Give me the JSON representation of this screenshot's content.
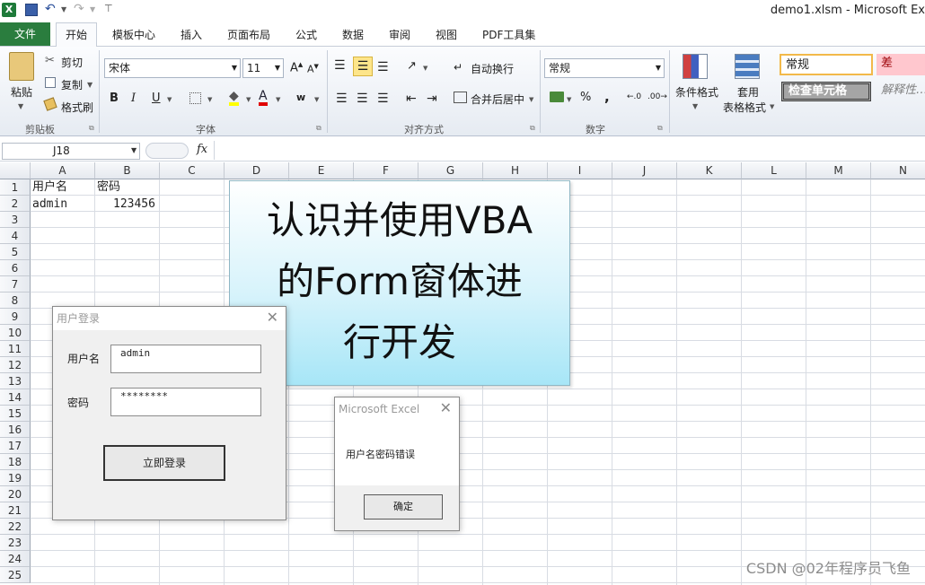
{
  "window": {
    "title": "demo1.xlsm - Microsoft Ex"
  },
  "tabs": [
    "文件",
    "开始",
    "模板中心",
    "插入",
    "页面布局",
    "公式",
    "数据",
    "审阅",
    "视图",
    "PDF工具集"
  ],
  "ribbon": {
    "clipboard": {
      "paste": "粘贴",
      "cut": "剪切",
      "copy": "复制",
      "format_painter": "格式刷",
      "label": "剪贴板"
    },
    "font": {
      "name": "宋体",
      "size": "11",
      "label": "字体"
    },
    "alignment": {
      "wrap": "自动换行",
      "merge": "合并后居中",
      "label": "对齐方式"
    },
    "number": {
      "format": "常规",
      "label": "数字"
    },
    "styles": {
      "conditional": "条件格式",
      "table_line1": "套用",
      "table_line2": "表格格式",
      "normal": "常规",
      "bad": "差",
      "check_cell": "检查单元格",
      "explanatory": "解释性…"
    }
  },
  "formula_bar": {
    "cell_ref": "J18",
    "fx": "fx",
    "value": ""
  },
  "columns": [
    "A",
    "B",
    "C",
    "D",
    "E",
    "F",
    "G",
    "H",
    "I",
    "J",
    "K",
    "L",
    "M",
    "N"
  ],
  "rows": [
    "1",
    "2",
    "3",
    "4",
    "5",
    "6",
    "7",
    "8",
    "9",
    "10",
    "11",
    "12",
    "13",
    "14",
    "15",
    "16",
    "17",
    "18",
    "19",
    "20",
    "21",
    "22",
    "23",
    "24",
    "25"
  ],
  "cells": {
    "A1": "用户名",
    "B1": "密码",
    "A2": "admin",
    "B2": "123456"
  },
  "shape_text": {
    "line1": "认识并使用VBA",
    "line2": "的Form窗体进",
    "line3": "行开发"
  },
  "login_dialog": {
    "title": "用户登录",
    "user_label": "用户名",
    "user_value": "admin",
    "pass_label": "密码",
    "pass_value": "********",
    "login_button": "立即登录"
  },
  "msgbox": {
    "title": "Microsoft Excel",
    "message": "用户名密码错误",
    "ok_button": "确定"
  },
  "watermark": "CSDN @02年程序员飞鱼"
}
